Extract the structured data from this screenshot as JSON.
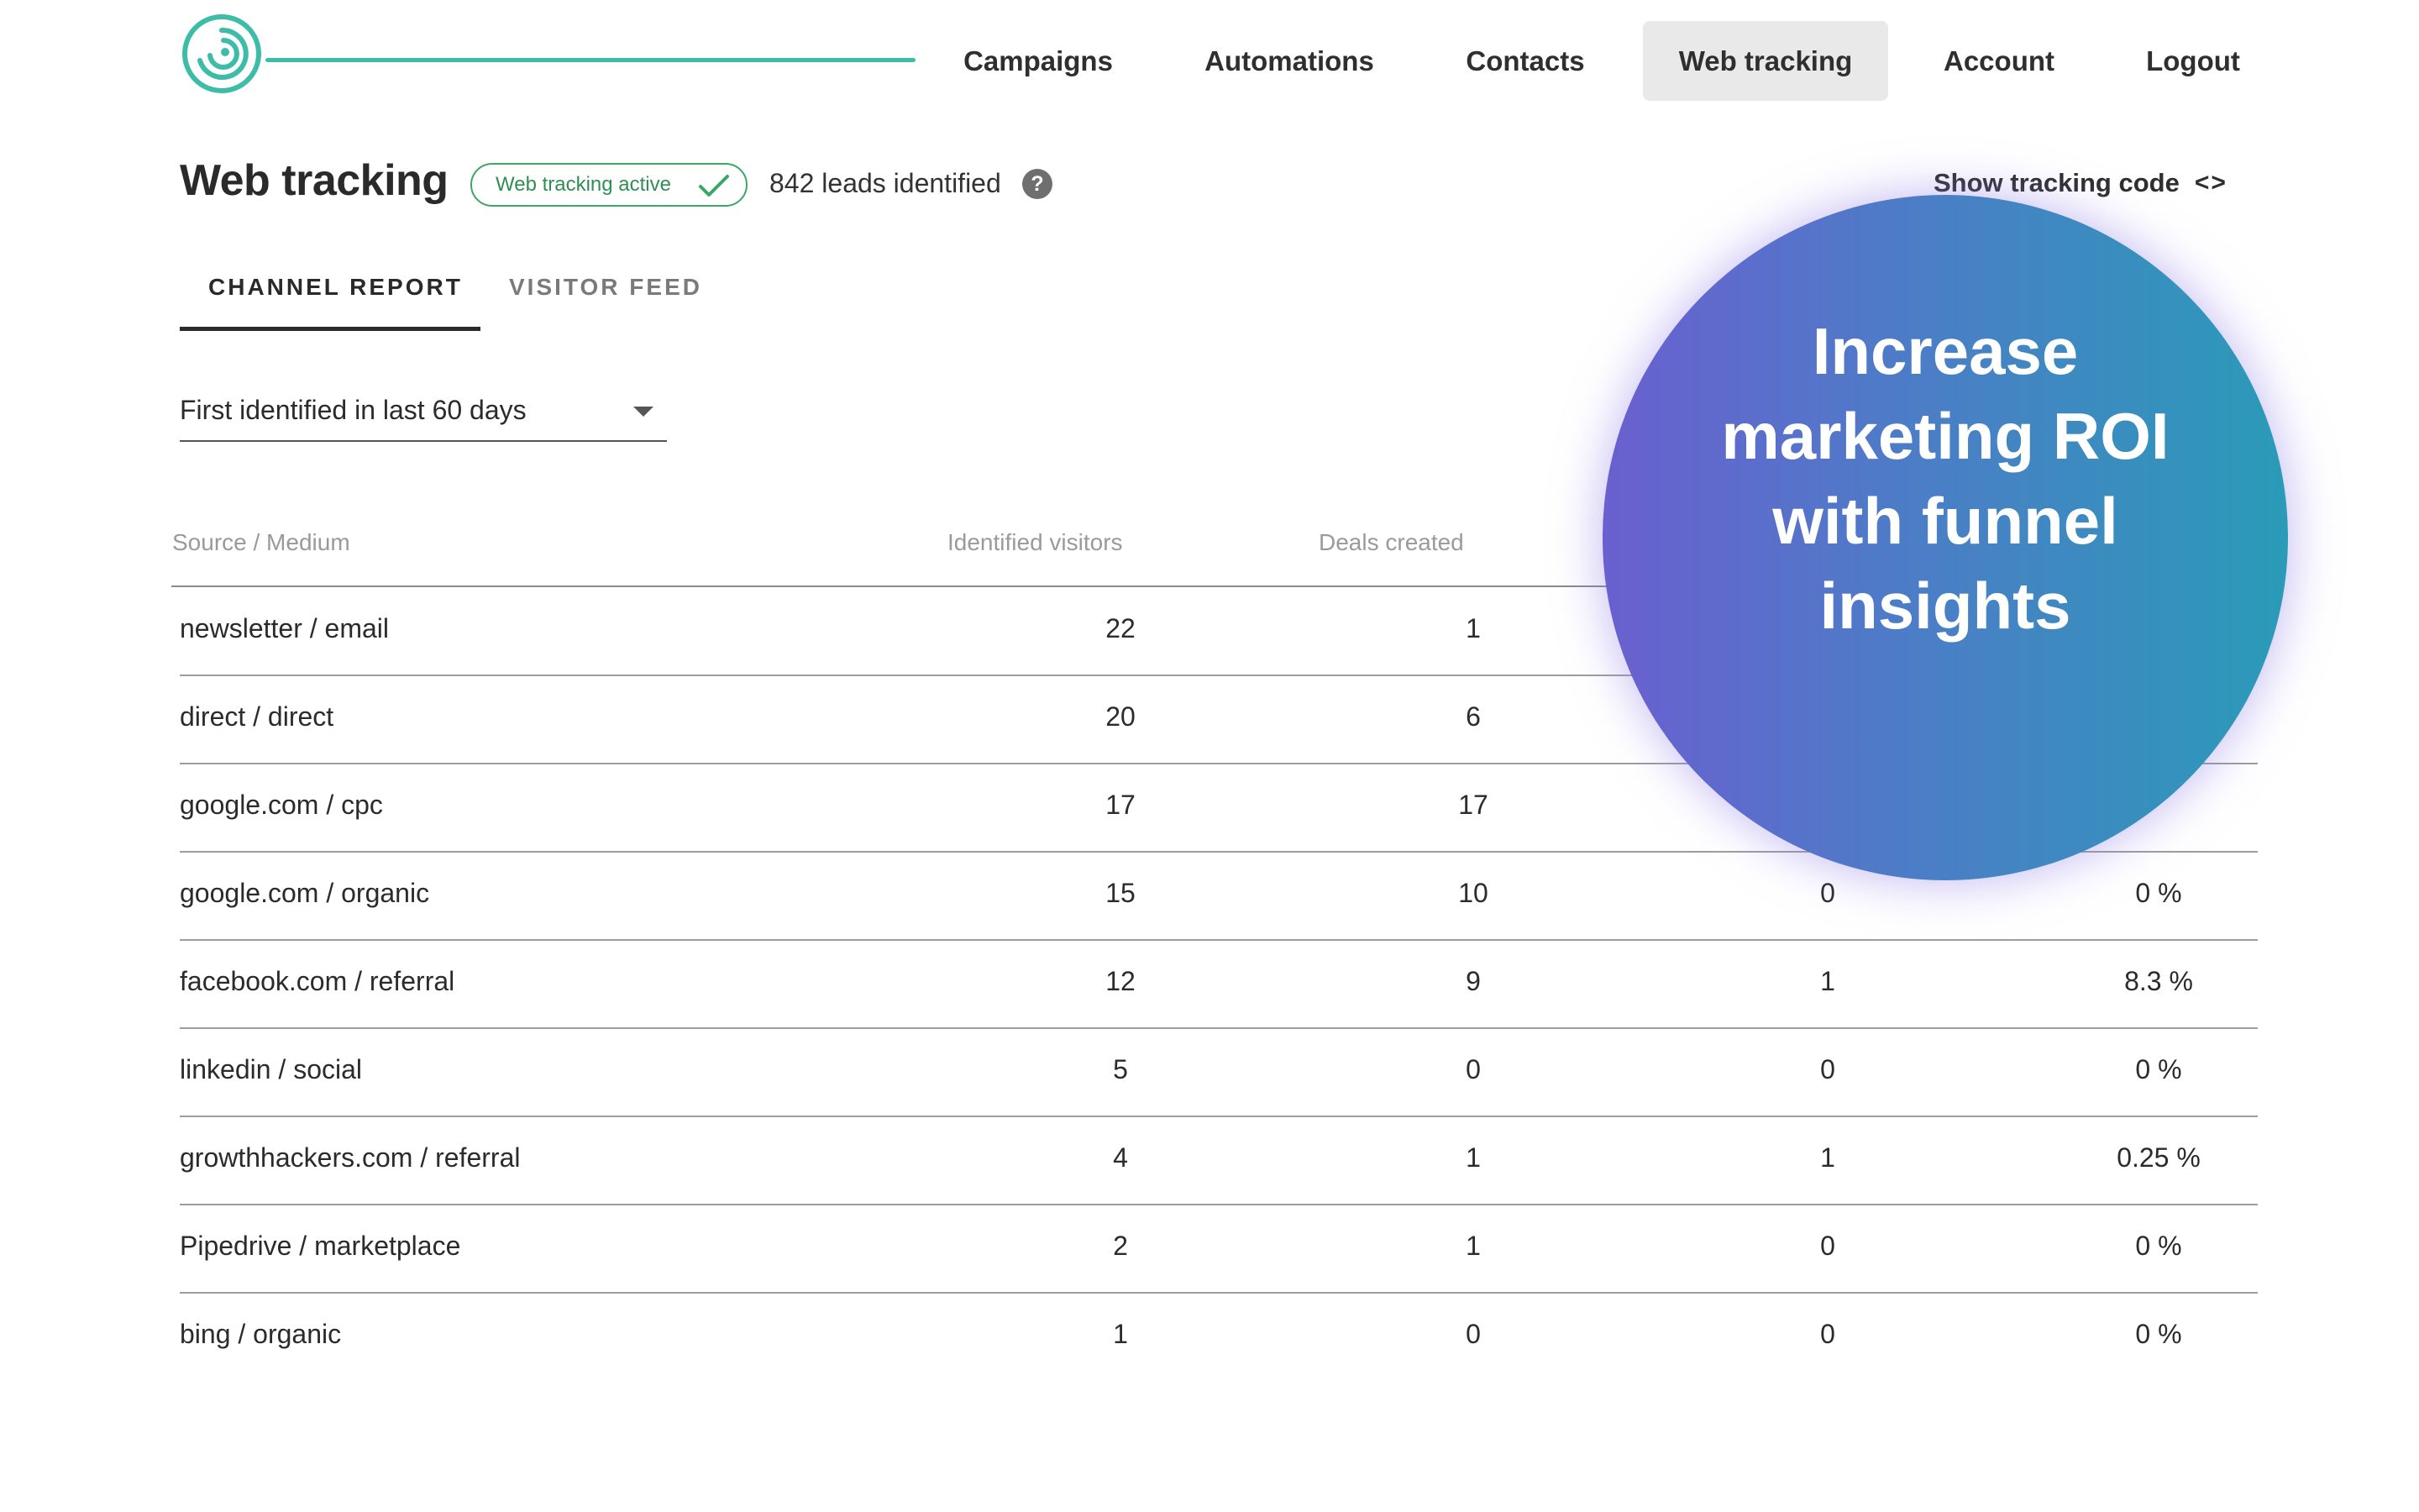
{
  "nav": {
    "items": [
      {
        "label": "Campaigns",
        "active": false
      },
      {
        "label": "Automations",
        "active": false
      },
      {
        "label": "Contacts",
        "active": false
      },
      {
        "label": "Web tracking",
        "active": true
      },
      {
        "label": "Account",
        "active": false
      },
      {
        "label": "Logout",
        "active": false
      }
    ]
  },
  "header": {
    "title": "Web tracking",
    "status_badge": "Web tracking active",
    "leads_text": "842 leads identified",
    "help_icon": "?",
    "tracking_code_link": "Show tracking code",
    "tracking_code_icon": "<>"
  },
  "tabs": [
    {
      "label": "CHANNEL REPORT",
      "active": true
    },
    {
      "label": "VISITOR FEED",
      "active": false
    }
  ],
  "filter": {
    "selected": "First identified in last 60 days"
  },
  "table": {
    "headers": {
      "source": "Source / Medium",
      "visitors": "Identified visitors",
      "deals": "Deals created"
    },
    "rows": [
      {
        "source": "newsletter / email",
        "visitors": "22",
        "deals": "1",
        "won": "",
        "rate": ""
      },
      {
        "source": "direct / direct",
        "visitors": "20",
        "deals": "6",
        "won": "",
        "rate": ""
      },
      {
        "source": "google.com / cpc",
        "visitors": "17",
        "deals": "17",
        "won": "",
        "rate": ""
      },
      {
        "source": "google.com / organic",
        "visitors": "15",
        "deals": "10",
        "won": "0",
        "rate": "0 %"
      },
      {
        "source": "facebook.com / referral",
        "visitors": "12",
        "deals": "9",
        "won": "1",
        "rate": "8.3 %"
      },
      {
        "source": "linkedin / social",
        "visitors": "5",
        "deals": "0",
        "won": "0",
        "rate": "0 %"
      },
      {
        "source": "growthhackers.com / referral",
        "visitors": "4",
        "deals": "1",
        "won": "1",
        "rate": "0.25 %"
      },
      {
        "source": "Pipedrive / marketplace",
        "visitors": "2",
        "deals": "1",
        "won": "0",
        "rate": "0 %"
      },
      {
        "source": "bing / organic",
        "visitors": "1",
        "deals": "0",
        "won": "0",
        "rate": "0 %"
      }
    ]
  },
  "promo": {
    "text": "Increase marketing ROI with funnel insights"
  },
  "colors": {
    "brand_teal": "#3dbca7",
    "active_green": "#3aa864",
    "promo_gradient_start": "#6a5fcf",
    "promo_gradient_end": "#2a9bb8"
  }
}
